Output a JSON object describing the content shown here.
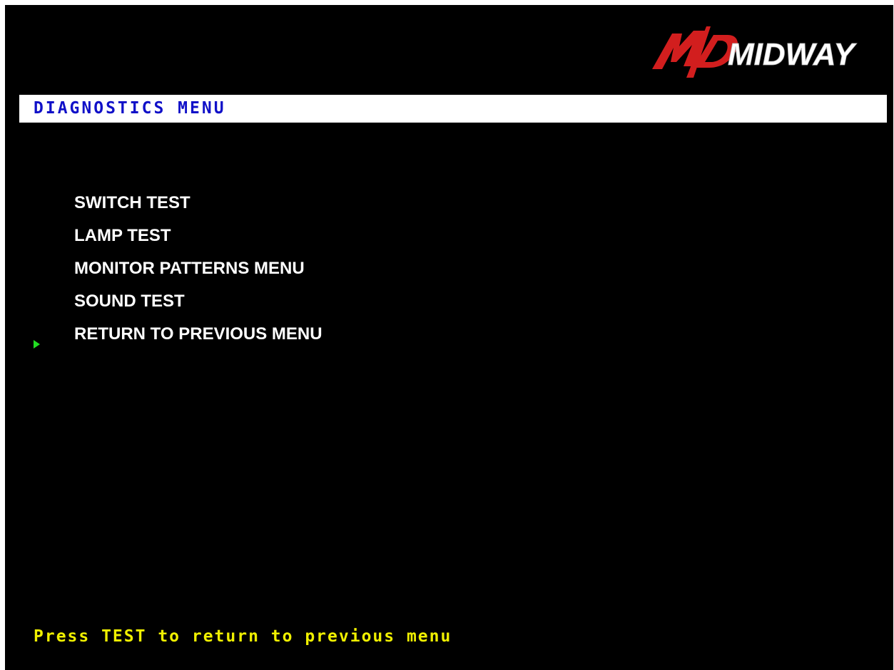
{
  "header": {
    "logo_text": "MIDWAY",
    "logo_icon": "midway-swoosh-logo",
    "colors": {
      "logo_red": "#d21e1e",
      "logo_white": "#ffffff"
    }
  },
  "title_bar": {
    "title": "DIAGNOSTICS MENU",
    "colors": {
      "background": "#ffffff",
      "text": "#1010c8"
    }
  },
  "menu": {
    "items": [
      {
        "label": "SWITCH TEST"
      },
      {
        "label": "LAMP TEST"
      },
      {
        "label": "MONITOR PATTERNS MENU"
      },
      {
        "label": "SOUND TEST"
      },
      {
        "label": "RETURN TO PREVIOUS MENU"
      }
    ],
    "selected_index": 4,
    "cursor_icon": "triangle-right-cursor-icon",
    "colors": {
      "text": "#ffffff",
      "cursor": "#22dd22"
    }
  },
  "footer": {
    "hint": "Press TEST to return to previous menu",
    "colors": {
      "text": "#f0f000"
    }
  },
  "colors": {
    "screen_background": "#000000"
  }
}
